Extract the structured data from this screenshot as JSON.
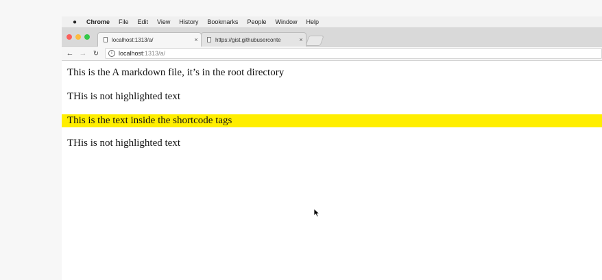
{
  "menubar": {
    "items": [
      "Chrome",
      "File",
      "Edit",
      "View",
      "History",
      "Bookmarks",
      "People",
      "Window",
      "Help"
    ]
  },
  "tabs": [
    {
      "title": "localhost:1313/a/",
      "close": "×"
    },
    {
      "title": "https://gist.githubuserconte",
      "close": "×"
    }
  ],
  "addressbar": {
    "host": "localhost",
    "path": ":1313/a/"
  },
  "page": {
    "paragraphs": [
      "This is the A markdown file, it’s in the root directory",
      "THis is not highlighted text",
      "This is the text inside the shortcode tags",
      "THis is not highlighted text"
    ],
    "highlight_color": "#ffee00"
  }
}
